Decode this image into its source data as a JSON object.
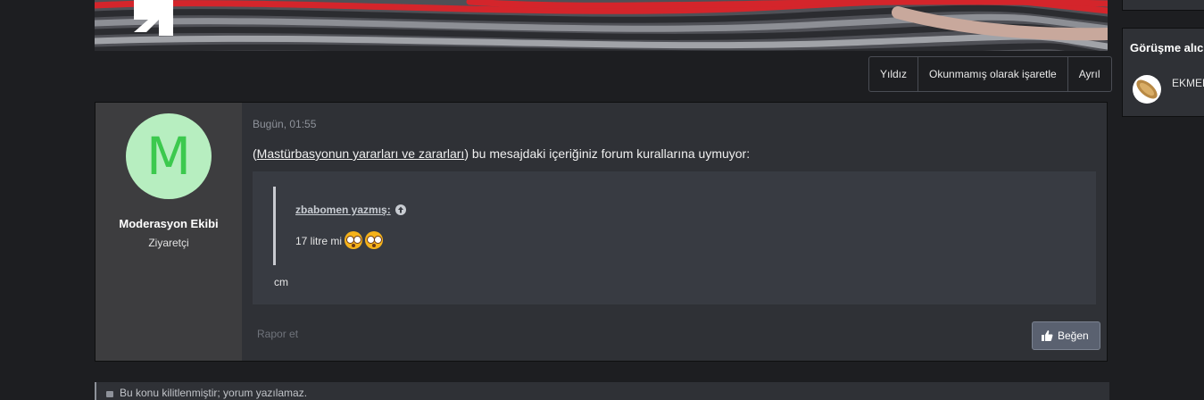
{
  "banner": {
    "logo_icon": "brand-logo-icon"
  },
  "thread_actions": [
    {
      "label": "Yıldız"
    },
    {
      "label": "Okunmamış olarak işaretle"
    },
    {
      "label": "Ayrıl"
    }
  ],
  "post": {
    "author": {
      "initial": "M",
      "name": "Moderasyon Ekibi",
      "title": "Ziyaretçi",
      "avatar_bg": "#b7eec0",
      "avatar_fg": "#3cc94e"
    },
    "date": "Bugün, 01:55",
    "body_prefix": "(",
    "body_link": "Mastürbasyonun yararları ve zararları",
    "body_suffix": ") bu mesajdaki içeriğiniz forum kurallarına uymuyor:",
    "quote": {
      "author": "zbabomen yazmış:",
      "text": "17 litre mi",
      "emojis": [
        "flushed-face-emoji",
        "flushed-face-emoji"
      ]
    },
    "quote_tail": "cm",
    "report_label": "Rapor et",
    "like_label": "Beğen"
  },
  "sidebar": {
    "conversation_title": "Görüşme alıcı",
    "participant_name": "EKMEK"
  },
  "bottom_bar": {
    "text": "Bu konu kilitlenmiştir; yorum yazılamaz."
  }
}
